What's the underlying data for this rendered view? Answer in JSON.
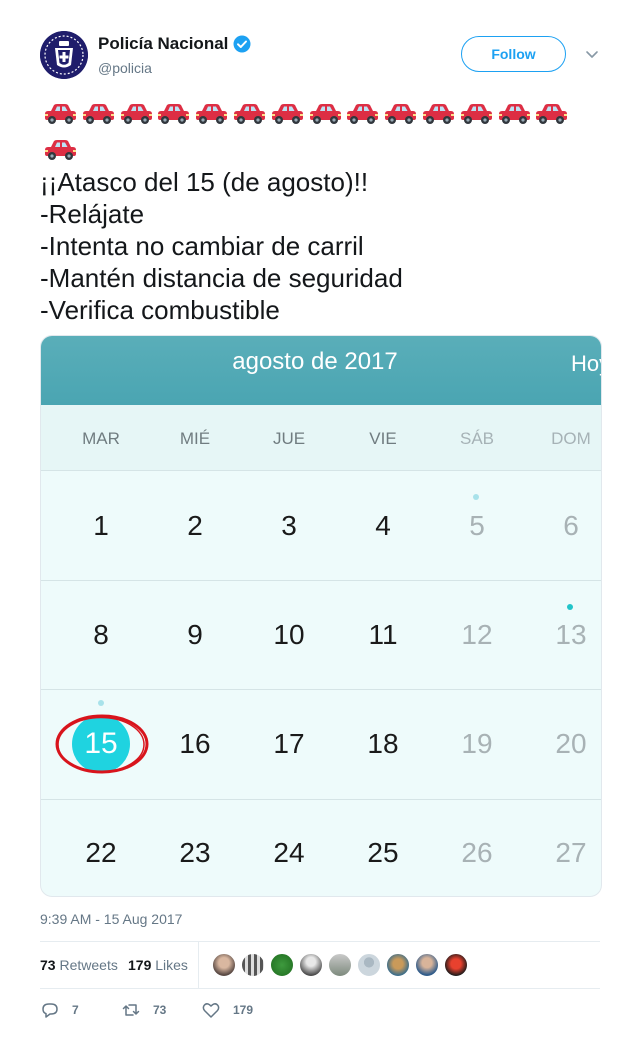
{
  "user": {
    "display_name": "Policía Nacional",
    "handle": "@policia",
    "verified": true,
    "follow_label": "Follow"
  },
  "tweet": {
    "car_emoji": "🚗",
    "car_count": 15,
    "lines": [
      "¡¡Atasco del 15 (de agosto)!!",
      "-Relájate",
      "-Intenta no cambiar de carril",
      "-Mantén distancia de seguridad",
      "-Verifica combustible"
    ]
  },
  "calendar": {
    "title": "agosto de 2017",
    "today_label": "Hoy",
    "weekdays": [
      "MAR",
      "MIÉ",
      "JUE",
      "VIE",
      "SÁB",
      "DOM"
    ],
    "weeks": [
      [
        "1",
        "2",
        "3",
        "4",
        "5",
        "6"
      ],
      [
        "8",
        "9",
        "10",
        "11",
        "12",
        "13"
      ],
      [
        "15",
        "16",
        "17",
        "18",
        "19",
        "20"
      ],
      [
        "22",
        "23",
        "24",
        "25",
        "26",
        "27"
      ]
    ],
    "selected_day": "15",
    "header_color": "#50a9b6",
    "selection_color": "#1fd3e0",
    "annotation_color": "#d8141c"
  },
  "meta": {
    "timestamp": "9:39 AM - 15 Aug 2017",
    "retweets_count": "73",
    "retweets_label": "Retweets",
    "likes_count": "179",
    "likes_label": "Likes"
  },
  "actions": {
    "reply_count": "7",
    "retweet_count": "73",
    "like_count": "179"
  },
  "colors": {
    "accent": "#1da1f2",
    "secondary_text": "#657786"
  }
}
